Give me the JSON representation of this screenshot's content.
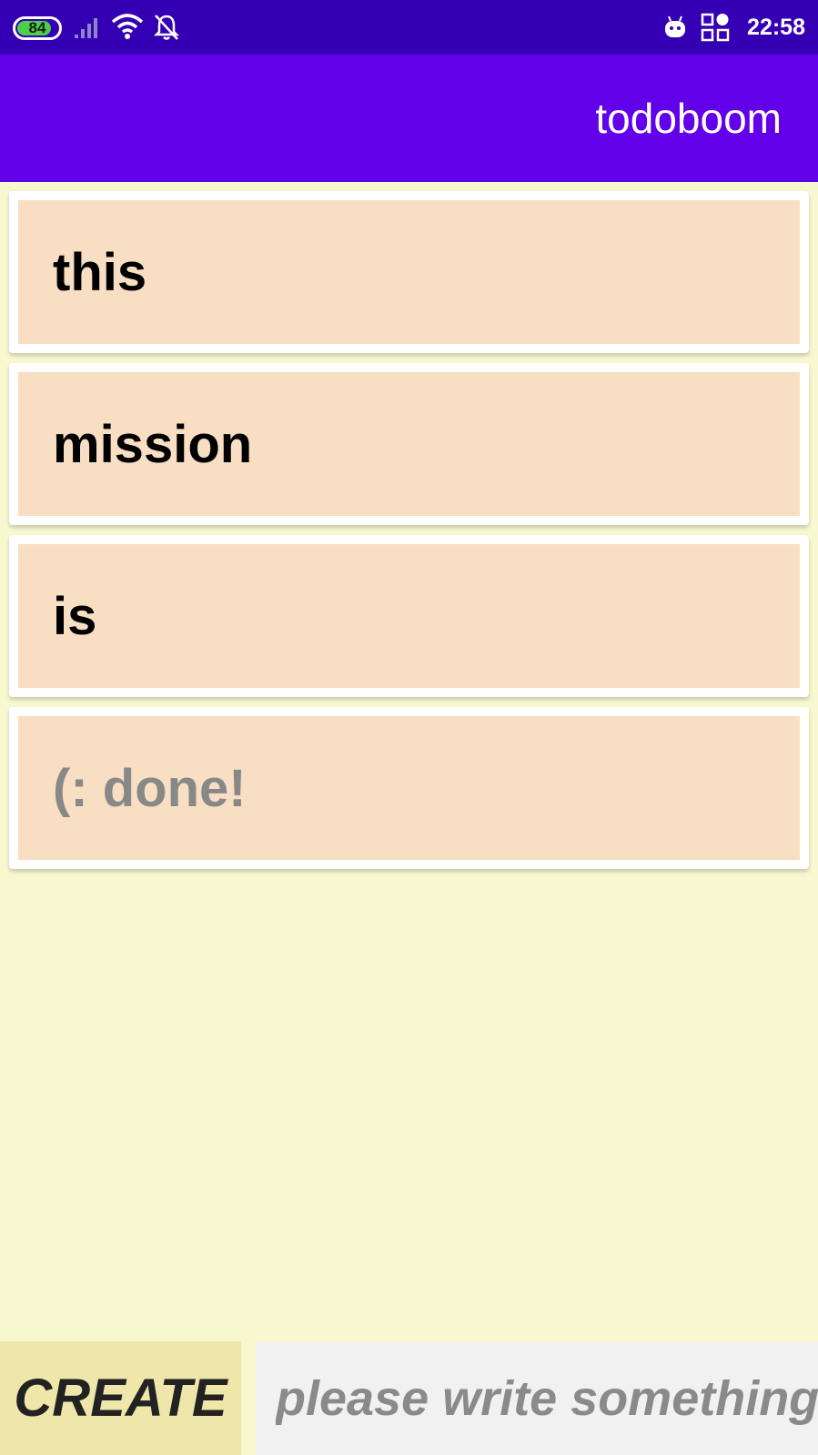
{
  "status_bar": {
    "battery": "84",
    "battery_level": 0.84,
    "time": "22:58",
    "icons": [
      "battery-icon",
      "signal-icon",
      "wifi-icon",
      "notifications-off-icon",
      "android-icon",
      "apps-icon"
    ]
  },
  "app_bar": {
    "title": "todoboom"
  },
  "todos": [
    {
      "text": "this",
      "done": false
    },
    {
      "text": "mission",
      "done": false
    },
    {
      "text": "is",
      "done": false
    },
    {
      "text": "(:  done!",
      "done": true
    }
  ],
  "bottom_bar": {
    "create_label": "CREATE",
    "input_placeholder": "please write something",
    "input_value": ""
  },
  "colors": {
    "status_bar": "#3500b3",
    "app_bar": "#6200ea",
    "background": "#f7f7d0",
    "card_inner": "#f8dec2",
    "create_button": "#efe6aa",
    "input_bg": "#f1f1f1"
  }
}
